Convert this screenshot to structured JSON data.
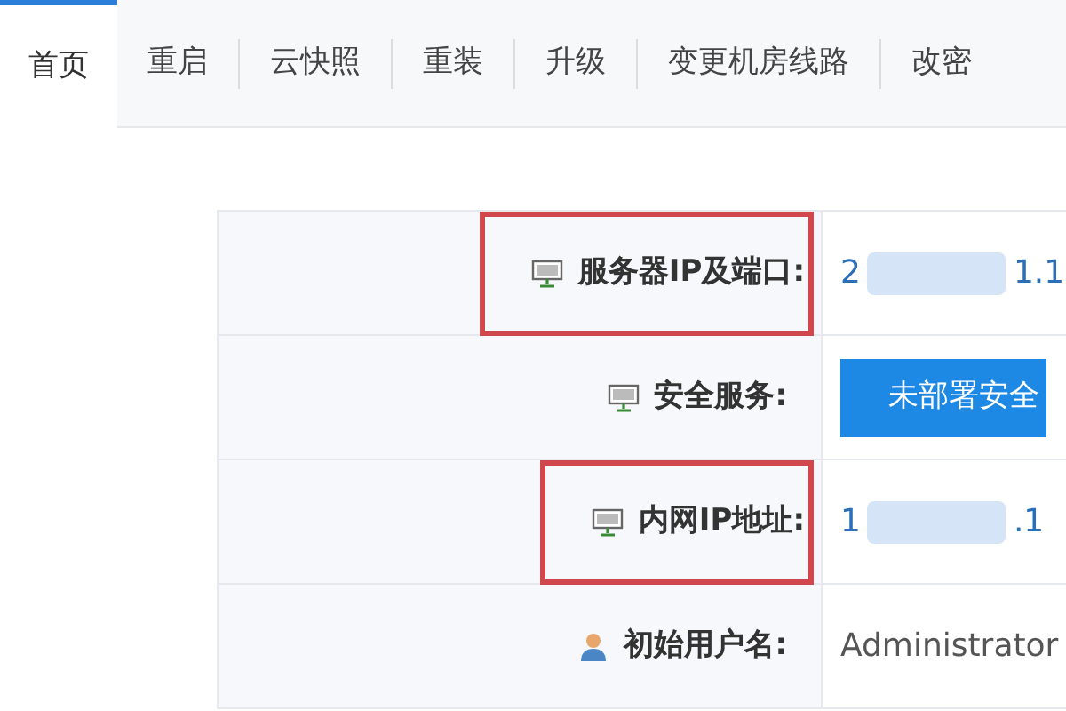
{
  "tabs": [
    {
      "label": "首页",
      "selected": true
    },
    {
      "label": "重启",
      "selected": false
    },
    {
      "label": "云快照",
      "selected": false
    },
    {
      "label": "重装",
      "selected": false
    },
    {
      "label": "升级",
      "selected": false
    },
    {
      "label": "变更机房线路",
      "selected": false
    },
    {
      "label": "改密",
      "selected": false
    }
  ],
  "rows": [
    {
      "label": {
        "kind": "monitor",
        "text": "服务器IP及端口:"
      },
      "highlighted": true,
      "kind": "redacted",
      "value_start": "2",
      "value_end": "1.1"
    },
    {
      "label": {
        "kind": "monitor",
        "text": "安全服务:"
      },
      "highlighted": false,
      "kind": "button",
      "value": "未部署安全"
    },
    {
      "label": {
        "kind": "monitor",
        "text": "内网IP地址:"
      },
      "highlighted": true,
      "kind": "redacted",
      "value_start": "1",
      "value_end": ".1"
    },
    {
      "label": {
        "kind": "user",
        "text": "初始用户名:"
      },
      "highlighted": false,
      "kind": "text",
      "value": "Administrator"
    }
  ]
}
